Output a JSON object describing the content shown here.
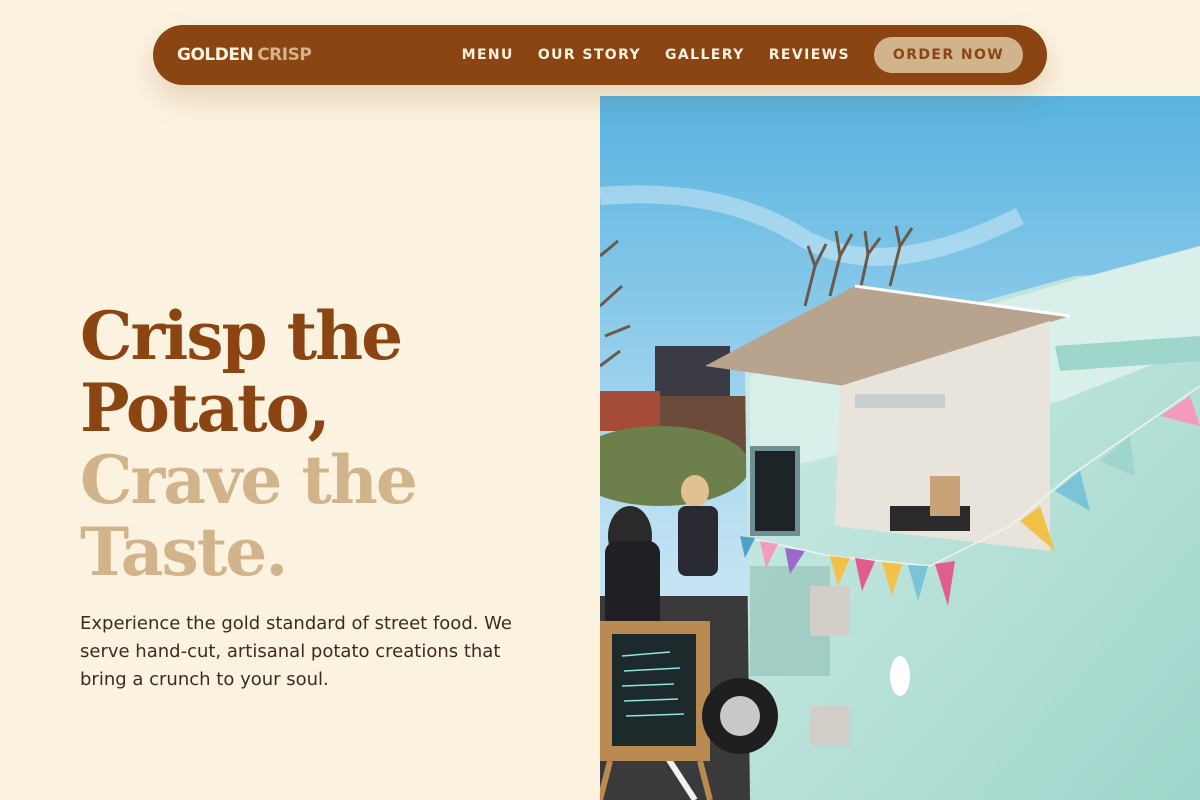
{
  "brand": {
    "name_part1": "GOLDEN",
    "name_part2": "CRISP"
  },
  "nav": {
    "links": [
      {
        "label": "MENU"
      },
      {
        "label": "OUR STORY"
      },
      {
        "label": "GALLERY"
      },
      {
        "label": "REVIEWS"
      }
    ],
    "cta_label": "ORDER NOW"
  },
  "hero": {
    "headline": {
      "line1": "Crisp the",
      "line2": "Potato,",
      "line3": "Crave the",
      "line4": "Taste."
    },
    "body": "Experience the gold standard of street food. We serve hand-cut, artisanal potato creations that bring a crunch to your soul."
  },
  "colors": {
    "background": "#fbf3e0",
    "brand_brown": "#8b4513",
    "brand_tan": "#d2b48c",
    "body_text": "#3d2b1f"
  },
  "icons": {
    "hero_image": "food-truck-photo"
  }
}
